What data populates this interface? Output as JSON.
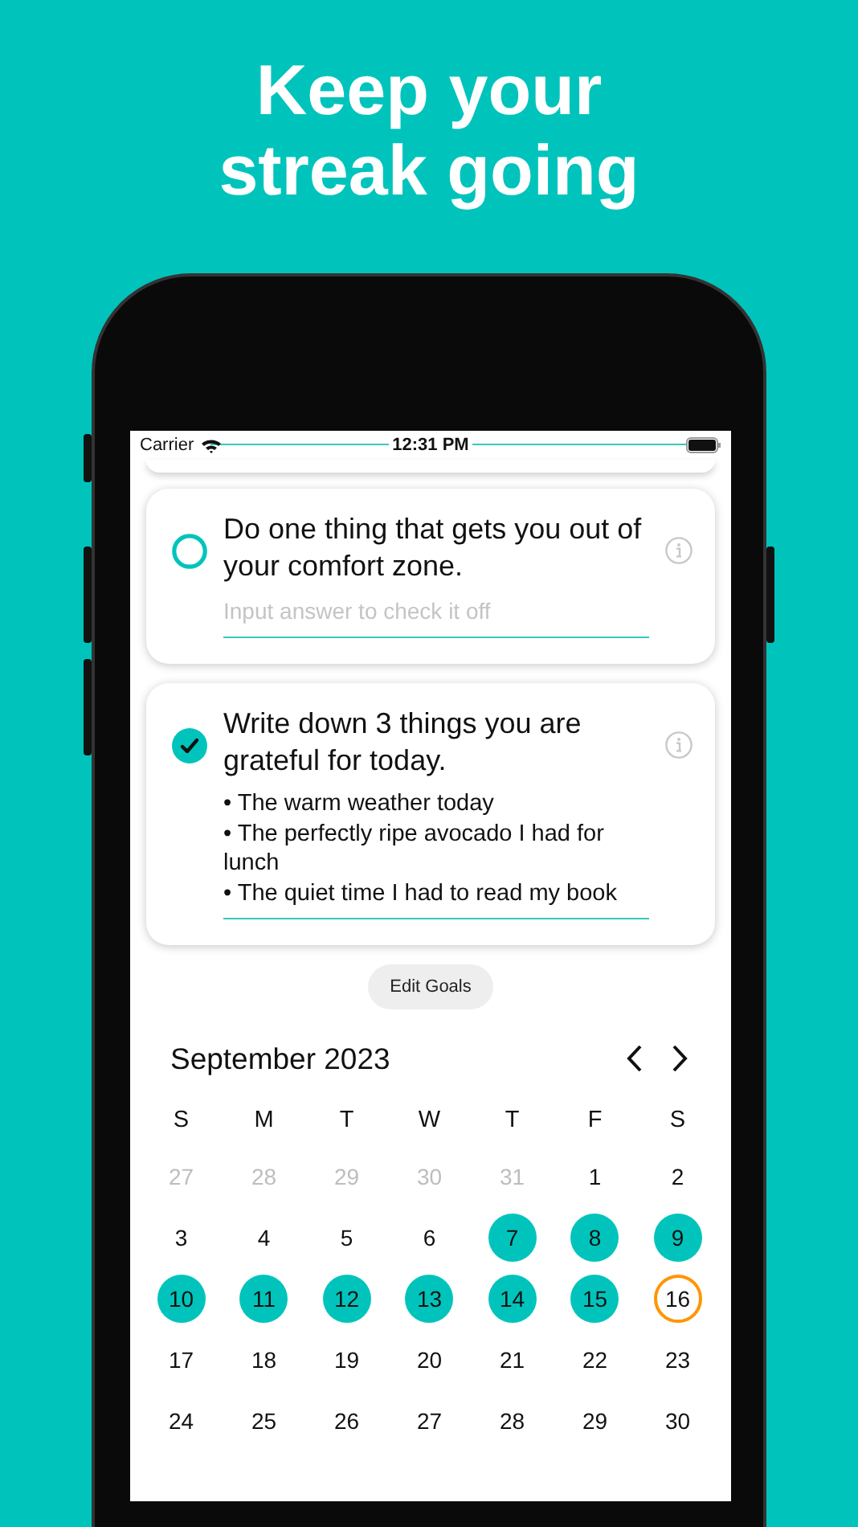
{
  "headline": [
    "Keep your",
    "streak going"
  ],
  "status_bar": {
    "carrier": "Carrier",
    "time": "12:31 PM"
  },
  "goals": [
    {
      "title": "Do one thing that gets you out of your comfort zone.",
      "checked": false,
      "placeholder": "Input answer to check it off"
    },
    {
      "title": "Write down 3 things you are grateful for today.",
      "checked": true,
      "answer": [
        "• The warm weather today",
        "• The perfectly ripe avocado I had for lunch",
        "• The quiet time I had to read my book"
      ]
    }
  ],
  "edit_button": "Edit Goals",
  "calendar": {
    "month": "September 2023",
    "weekdays": [
      "S",
      "M",
      "T",
      "W",
      "T",
      "F",
      "S"
    ],
    "days": [
      {
        "label": "27",
        "kind": "outside"
      },
      {
        "label": "28",
        "kind": "outside"
      },
      {
        "label": "29",
        "kind": "outside"
      },
      {
        "label": "30",
        "kind": "outside"
      },
      {
        "label": "31",
        "kind": "outside"
      },
      {
        "label": "1",
        "kind": "plain"
      },
      {
        "label": "2",
        "kind": "plain"
      },
      {
        "label": "3",
        "kind": "plain"
      },
      {
        "label": "4",
        "kind": "plain"
      },
      {
        "label": "5",
        "kind": "plain"
      },
      {
        "label": "6",
        "kind": "plain"
      },
      {
        "label": "7",
        "kind": "done"
      },
      {
        "label": "8",
        "kind": "done"
      },
      {
        "label": "9",
        "kind": "done"
      },
      {
        "label": "10",
        "kind": "done"
      },
      {
        "label": "11",
        "kind": "done"
      },
      {
        "label": "12",
        "kind": "done"
      },
      {
        "label": "13",
        "kind": "done"
      },
      {
        "label": "14",
        "kind": "done"
      },
      {
        "label": "15",
        "kind": "done"
      },
      {
        "label": "16",
        "kind": "today"
      },
      {
        "label": "17",
        "kind": "plain"
      },
      {
        "label": "18",
        "kind": "plain"
      },
      {
        "label": "19",
        "kind": "plain"
      },
      {
        "label": "20",
        "kind": "plain"
      },
      {
        "label": "21",
        "kind": "plain"
      },
      {
        "label": "22",
        "kind": "plain"
      },
      {
        "label": "23",
        "kind": "plain"
      },
      {
        "label": "24",
        "kind": "plain"
      },
      {
        "label": "25",
        "kind": "plain"
      },
      {
        "label": "26",
        "kind": "plain"
      },
      {
        "label": "27",
        "kind": "plain"
      },
      {
        "label": "28",
        "kind": "plain"
      },
      {
        "label": "29",
        "kind": "plain"
      },
      {
        "label": "30",
        "kind": "plain"
      }
    ]
  }
}
